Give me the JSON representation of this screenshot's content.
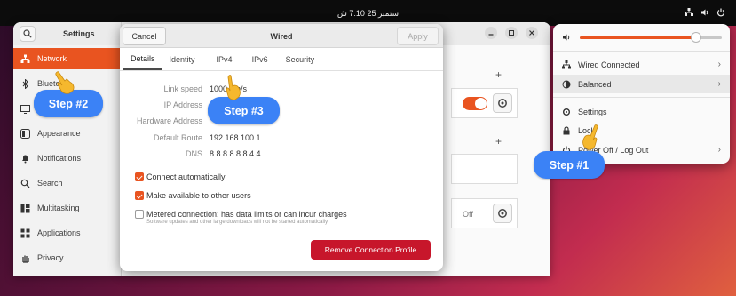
{
  "topbar": {
    "clock": "ستمبر 25  7:10 ش",
    "tray": [
      "network-icon",
      "volume-icon",
      "power-icon"
    ]
  },
  "settings": {
    "title": "Settings",
    "sidebar": [
      {
        "label": "Network",
        "icon": "network-icon",
        "active": true
      },
      {
        "label": "Blueto",
        "icon": "bluetooth-icon",
        "active": false
      },
      {
        "label": "",
        "icon": "background-icon",
        "active": false
      },
      {
        "label": "Appearance",
        "icon": "appearance-icon",
        "active": false
      },
      {
        "label": "Notifications",
        "icon": "bell-icon",
        "active": false
      },
      {
        "label": "Search",
        "icon": "search-icon",
        "active": false
      },
      {
        "label": "Multitasking",
        "icon": "multitasking-icon",
        "active": false
      },
      {
        "label": "Applications",
        "icon": "grid-icon",
        "active": false
      },
      {
        "label": "Privacy",
        "icon": "hand-icon",
        "active": false
      }
    ],
    "vpn_state": "Off"
  },
  "dialog": {
    "title": "Wired",
    "cancel_label": "Cancel",
    "apply_label": "Apply",
    "tabs": [
      "Details",
      "Identity",
      "IPv4",
      "IPv6",
      "Security"
    ],
    "active_tab": "Details",
    "details": [
      {
        "key": "Link speed",
        "value": "1000 Mb/s"
      },
      {
        "key": "IP Address",
        "value": ""
      },
      {
        "key": "Hardware Address",
        "value": ""
      },
      {
        "key": "Default Route",
        "value": "192.168.100.1"
      },
      {
        "key": "DNS",
        "value": "8.8.8.8 8.8.4.4"
      }
    ],
    "checks": [
      {
        "label": "Connect automatically",
        "checked": true
      },
      {
        "label": "Make available to other users",
        "checked": true
      },
      {
        "label": "Metered connection: has data limits or can incur charges",
        "checked": false
      }
    ],
    "metered_note": "Software updates and other large downloads will not be started automatically.",
    "remove_label": "Remove Connection Profile"
  },
  "quick_settings": {
    "volume_percent": 82,
    "items": [
      {
        "label": "Wired Connected",
        "icon": "network-icon",
        "submenu": true
      },
      {
        "label": "Balanced",
        "icon": "power-profile-icon",
        "submenu": true
      },
      {
        "label": "Settings",
        "icon": "gear-icon",
        "submenu": false
      },
      {
        "label": "Lock",
        "icon": "lock-icon",
        "submenu": false
      },
      {
        "label": "Power Off / Log Out",
        "icon": "power-icon",
        "submenu": true
      }
    ]
  },
  "annotations": [
    {
      "label": "Step #1"
    },
    {
      "label": "Step #2"
    },
    {
      "label": "Step #3"
    }
  ],
  "colors": {
    "accent": "#e95420",
    "danger": "#c7162b",
    "step": "#3b82f6",
    "hand": "#f5b82e"
  }
}
